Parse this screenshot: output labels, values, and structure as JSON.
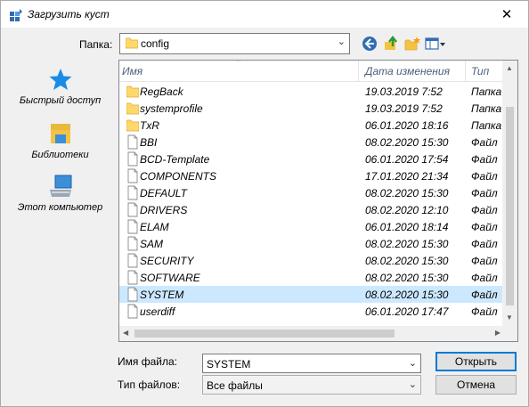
{
  "window": {
    "title": "Загрузить куст",
    "close_label": "✕"
  },
  "folder": {
    "label": "Папка:",
    "value": "config"
  },
  "places": [
    {
      "label": "Быстрый доступ",
      "icon": "star-icon"
    },
    {
      "label": "Библиотеки",
      "icon": "libraries-icon"
    },
    {
      "label": "Этот компьютер",
      "icon": "computer-icon"
    }
  ],
  "columns": {
    "name": "Имя",
    "date": "Дата изменения",
    "type": "Тип"
  },
  "files": [
    {
      "name": "RegBack",
      "date": "19.03.2019 7:52",
      "type": "Папка",
      "kind": "folder",
      "selected": false
    },
    {
      "name": "systemprofile",
      "date": "19.03.2019 7:52",
      "type": "Папка",
      "kind": "folder",
      "selected": false
    },
    {
      "name": "TxR",
      "date": "06.01.2020 18:16",
      "type": "Папка",
      "kind": "folder",
      "selected": false
    },
    {
      "name": "BBI",
      "date": "08.02.2020 15:30",
      "type": "Файл",
      "kind": "file",
      "selected": false
    },
    {
      "name": "BCD-Template",
      "date": "06.01.2020 17:54",
      "type": "Файл",
      "kind": "file",
      "selected": false
    },
    {
      "name": "COMPONENTS",
      "date": "17.01.2020 21:34",
      "type": "Файл",
      "kind": "file",
      "selected": false
    },
    {
      "name": "DEFAULT",
      "date": "08.02.2020 15:30",
      "type": "Файл",
      "kind": "file",
      "selected": false
    },
    {
      "name": "DRIVERS",
      "date": "08.02.2020 12:10",
      "type": "Файл",
      "kind": "file",
      "selected": false
    },
    {
      "name": "ELAM",
      "date": "06.01.2020 18:14",
      "type": "Файл",
      "kind": "file",
      "selected": false
    },
    {
      "name": "SAM",
      "date": "08.02.2020 15:30",
      "type": "Файл",
      "kind": "file",
      "selected": false
    },
    {
      "name": "SECURITY",
      "date": "08.02.2020 15:30",
      "type": "Файл",
      "kind": "file",
      "selected": false
    },
    {
      "name": "SOFTWARE",
      "date": "08.02.2020 15:30",
      "type": "Файл",
      "kind": "file",
      "selected": false
    },
    {
      "name": "SYSTEM",
      "date": "08.02.2020 15:30",
      "type": "Файл",
      "kind": "file",
      "selected": true
    },
    {
      "name": "userdiff",
      "date": "06.01.2020 17:47",
      "type": "Файл",
      "kind": "file",
      "selected": false
    }
  ],
  "filename": {
    "label": "Имя файла:",
    "value": "SYSTEM"
  },
  "filetype": {
    "label": "Тип файлов:",
    "value": "Все файлы"
  },
  "buttons": {
    "open": "Открыть",
    "cancel": "Отмена"
  },
  "colors": {
    "selection": "#cce8ff",
    "accent": "#0078d7",
    "folder": "#ffd86b"
  }
}
